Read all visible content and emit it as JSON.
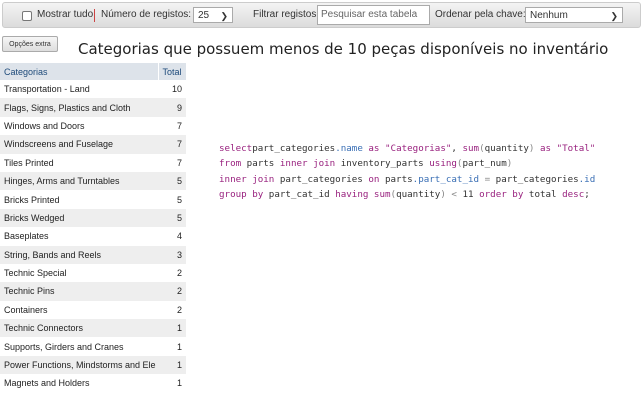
{
  "toolbar": {
    "show_all": "Mostrar tudo",
    "records_label": "Número de registos:",
    "records_value": "25",
    "filter_label": "Filtrar registos:",
    "filter_placeholder": "Pesquisar esta tabela",
    "sort_label": "Ordenar pela chave:",
    "sort_value": "Nenhum"
  },
  "extra_button": "Opções extra",
  "title": "Categorias que possuem menos de 10 peças disponíveis no inventário",
  "table": {
    "headers": [
      "Categorias",
      "Total"
    ],
    "rows": [
      [
        "Transportation - Land",
        "10"
      ],
      [
        "Flags, Signs, Plastics and Cloth",
        "9"
      ],
      [
        "Windows and Doors",
        "7"
      ],
      [
        "Windscreens and Fuselage",
        "7"
      ],
      [
        "Tiles Printed",
        "7"
      ],
      [
        "Hinges, Arms and Turntables",
        "5"
      ],
      [
        "Bricks Printed",
        "5"
      ],
      [
        "Bricks Wedged",
        "5"
      ],
      [
        "Baseplates",
        "4"
      ],
      [
        "String, Bands and Reels",
        "3"
      ],
      [
        "Technic Special",
        "2"
      ],
      [
        "Technic Pins",
        "2"
      ],
      [
        "Containers",
        "2"
      ],
      [
        "Technic Connectors",
        "1"
      ],
      [
        "Supports, Girders and Cranes",
        "1"
      ],
      [
        "Power Functions, Mindstorms and Ele",
        "1"
      ],
      [
        "Magnets and Holders",
        "1"
      ]
    ]
  },
  "sql": {
    "l1": [
      [
        "kw",
        "select"
      ],
      [
        "",
        "part_categories"
      ],
      [
        "at",
        ".name"
      ],
      [
        "kw",
        " as "
      ],
      [
        "st",
        "\"Categorias\""
      ],
      [
        "",
        ", "
      ],
      [
        "kw",
        "sum"
      ],
      [
        "pn",
        "("
      ],
      [
        "",
        "quantity"
      ],
      [
        "pn",
        ")"
      ],
      [
        "kw",
        " as "
      ],
      [
        "st",
        "\"Total\""
      ]
    ],
    "l2": [
      [
        "kw",
        "from"
      ],
      [
        "",
        " parts "
      ],
      [
        "kw",
        "inner join"
      ],
      [
        "",
        " inventory_parts "
      ],
      [
        "kw",
        "using"
      ],
      [
        "pn",
        "("
      ],
      [
        "",
        "part_num"
      ],
      [
        "pn",
        ")"
      ]
    ],
    "l3": [
      [
        "kw",
        "inner join"
      ],
      [
        "",
        " part_categories "
      ],
      [
        "kw",
        "on"
      ],
      [
        "",
        " parts"
      ],
      [
        "at",
        ".part_cat_id"
      ],
      [
        "pn",
        " = "
      ],
      [
        "",
        "part_categories"
      ],
      [
        "at",
        ".id"
      ]
    ],
    "l4": [
      [
        "kw",
        "group by"
      ],
      [
        "",
        " part_cat_id "
      ],
      [
        "kw",
        "having"
      ],
      [
        " kw",
        " sum"
      ],
      [
        "pn",
        "("
      ],
      [
        "",
        "quantity"
      ],
      [
        "pn",
        ")"
      ],
      [
        "pn",
        " < "
      ],
      [
        "",
        "11 "
      ],
      [
        "kw",
        "order by"
      ],
      [
        "",
        " total "
      ],
      [
        "kw",
        "desc"
      ],
      [
        "",
        ";"
      ]
    ]
  }
}
